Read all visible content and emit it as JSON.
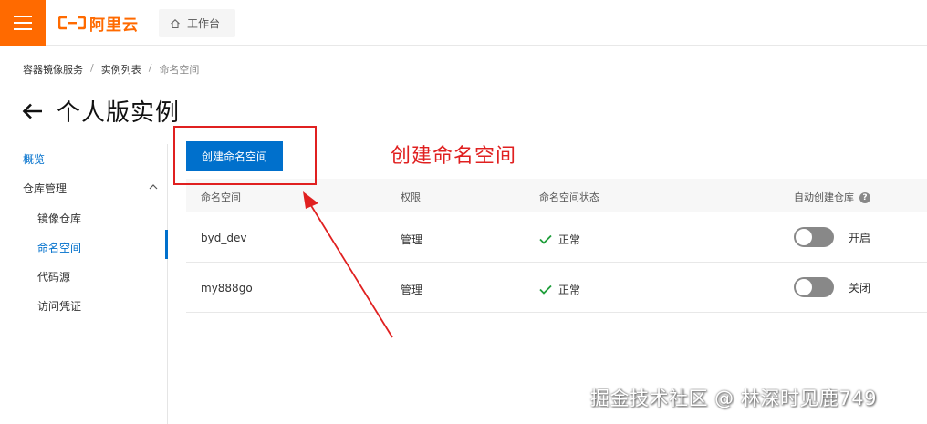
{
  "header": {
    "logo_text": "阿里云",
    "workbench_label": "工作台",
    "brand_color": "#ff6a00"
  },
  "breadcrumb": {
    "items": [
      "容器镜像服务",
      "实例列表",
      "命名空间"
    ],
    "separator": "/"
  },
  "page": {
    "title": "个人版实例",
    "back_icon": "arrow-left-icon"
  },
  "sidebar": {
    "overview": "概览",
    "repo_management": "仓库管理",
    "items": [
      {
        "label": "镜像仓库",
        "active": false
      },
      {
        "label": "命名空间",
        "active": true
      },
      {
        "label": "代码源",
        "active": false
      },
      {
        "label": "访问凭证",
        "active": false
      }
    ]
  },
  "toolbar": {
    "create_label": "创建命名空间"
  },
  "annotation": {
    "text": "创建命名空间",
    "color": "#e02020"
  },
  "table": {
    "headers": [
      "命名空间",
      "权限",
      "命名空间状态",
      "自动创建仓库"
    ],
    "rows": [
      {
        "namespace": "byd_dev",
        "permission": "管理",
        "status": "正常",
        "auto_create": "开启"
      },
      {
        "namespace": "my888go",
        "permission": "管理",
        "status": "正常",
        "auto_create": "关闭"
      }
    ]
  },
  "watermark": "掘金技术社区 @ 林深时见鹿749",
  "accent_color": "#0070cc"
}
